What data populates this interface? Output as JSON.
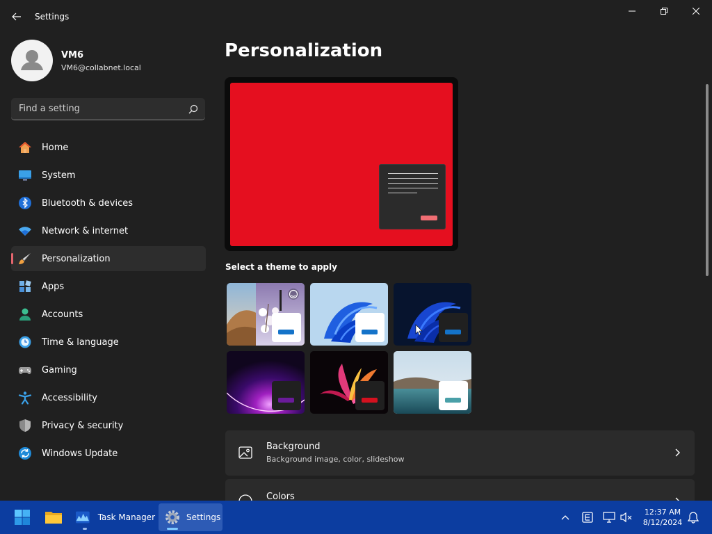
{
  "app": {
    "title": "Settings"
  },
  "profile": {
    "name": "VM6",
    "email": "VM6@collabnet.local"
  },
  "search": {
    "placeholder": "Find a setting"
  },
  "nav": [
    {
      "label": "Home",
      "icon": "home-icon"
    },
    {
      "label": "System",
      "icon": "system-icon"
    },
    {
      "label": "Bluetooth & devices",
      "icon": "bluetooth-icon"
    },
    {
      "label": "Network & internet",
      "icon": "wifi-icon"
    },
    {
      "label": "Personalization",
      "icon": "brush-icon",
      "active": true
    },
    {
      "label": "Apps",
      "icon": "apps-icon"
    },
    {
      "label": "Accounts",
      "icon": "account-icon"
    },
    {
      "label": "Time & language",
      "icon": "clock-icon"
    },
    {
      "label": "Gaming",
      "icon": "gamepad-icon"
    },
    {
      "label": "Accessibility",
      "icon": "accessibility-icon"
    },
    {
      "label": "Privacy & security",
      "icon": "shield-icon"
    },
    {
      "label": "Windows Update",
      "icon": "update-icon"
    }
  ],
  "main": {
    "title": "Personalization",
    "themes_label": "Select a theme to apply",
    "themes": [
      {
        "name": "spotlight",
        "bar_color": "#1473c9"
      },
      {
        "name": "windows-light",
        "bar_color": "#1473c9"
      },
      {
        "name": "windows-dark",
        "bar_color": "#1473c9"
      },
      {
        "name": "glow",
        "bar_color": "#6a1b9a"
      },
      {
        "name": "captured-motion",
        "bar_color": "#d4111f"
      },
      {
        "name": "flow",
        "bar_color": "#4aa0a8"
      }
    ],
    "cards": [
      {
        "title": "Background",
        "subtitle": "Background image, color, slideshow",
        "icon": "image-icon"
      },
      {
        "title": "Colors",
        "subtitle": "",
        "icon": "palette-icon"
      }
    ]
  },
  "colors": {
    "accent": "#e50f1f",
    "nav_indicator": "#e3656e",
    "taskbar": "#0c3da0"
  },
  "taskbar": {
    "apps": [
      {
        "label": "",
        "icon": "start-icon"
      },
      {
        "label": "",
        "icon": "file-explorer-icon"
      },
      {
        "label": "Task Manager",
        "icon": "task-manager-icon"
      },
      {
        "label": "Settings",
        "icon": "settings-gear-icon",
        "active": true
      }
    ],
    "clock": {
      "time": "12:37 AM",
      "date": "8/12/2024"
    }
  }
}
